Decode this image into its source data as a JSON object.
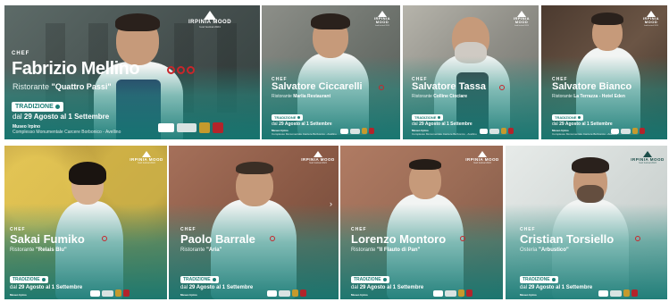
{
  "event": {
    "logo_title": "IRPINIA MOOD",
    "logo_sub": "food festival 2024",
    "chef_word": "CHEF",
    "badge": "TRADIZIONE",
    "date_prefix": "dal",
    "date_text": "29 Agosto al 1 Settembre",
    "venue_name": "Museo Irpino",
    "venue_sub": "Complesso Monumentale Carcere Borbonico - Avellino",
    "brand_color": "#1d7f77"
  },
  "cards": [
    {
      "name": "Fabrizio Mellino",
      "prefix": "Ristorante",
      "restaurant": "\"Quattro Passi\""
    },
    {
      "name": "Salvatore Ciccarelli",
      "prefix": "Ristorante",
      "restaurant": "Marlia Restaurant"
    },
    {
      "name": "Salvatore Tassa",
      "prefix": "Ristorante",
      "restaurant": "Colline Ciociare"
    },
    {
      "name": "Salvatore Bianco",
      "prefix": "Ristorante",
      "restaurant": "La Terrazza - Hotel Eden"
    },
    {
      "name": "Sakai Fumiko",
      "prefix": "Ristorante",
      "restaurant": "\"Relais Blu\""
    },
    {
      "name": "Paolo Barrale",
      "prefix": "Ristorante",
      "restaurant": "\"Aria\""
    },
    {
      "name": "Lorenzo Montoro",
      "prefix": "Ristorante",
      "restaurant": "\"Il Flauto di Pan\""
    },
    {
      "name": "Cristian Torsiello",
      "prefix": "Osteria",
      "restaurant": "\"Arbustico\""
    }
  ]
}
